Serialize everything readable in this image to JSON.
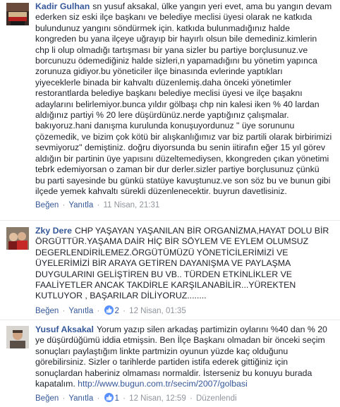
{
  "comments": [
    {
      "author": "Kadir Gulhan",
      "lines": [
        "sn yusuf aksakal, ülke yangın yeri evet, ama bu yangın devam",
        "ederken siz eski ilçe başkanı ve belediye meclisi üyesi olarak ne katkıda",
        "bulundunuz yangını söndürmek için. katkıda bulunmadığınız halde",
        "kongreden bu yana ilçeye uğrayıp bir hayırlı olsun bile demediniz.kimlerin",
        "chp li olup olmadığı tartışması bir yana sizler bu partiye borçlusunuz.ve",
        "borcunuzu ödemediğiniz halde sizleri,n yapamadığını bu yönetim yapınca",
        "zorunuza gidiyor.bu yöneticiler ilçe binasında evlerinde yaptıkları",
        "yiyeceklerle binada bir kahvaltı düzenlemiş.daha önceki yönetimler",
        "restorantlarda belediye başkanı belediye meclisi üyesi ve ilçe başaknı",
        "adaylarını belirlemiyor.bunca yıldır gölbaşı chp nin kalesi iken % 40 lardan",
        "aldığınız partiyi % 20 lere düşürdünüz.nerde yaptığınız çalışmalar.",
        "bakıyoruz.hani danışma kurulunda konuşuyordunuz \" üye sorununu",
        "çözemedik, ve bizim çok kötü bir alışkanlığımız var biz partili olarak birbirimizi",
        "sevmiyoruz\" demiştiniz. doğru diyorsunda bu senin iitirafın eğer 15 yıl görev",
        "aldığın bir partinin üye yapısını düzeltemediysen, kkongreden çıkan yönetimi",
        "tebrk edemiyorsan o zaman bir dur derler.sizler partiye borçlusunuz çünkü",
        "bu parti sayesinde bu günkü statüye kavuştunuz.ve son söz bu ve bunun gibi",
        "ilçede yemek kahvaltı sürekli düzenlenecektir. buyrun davetlisiniz."
      ],
      "like": "Beğen",
      "reply": "Yanıtla",
      "date": "11 Nisan, 21:31"
    },
    {
      "author": "Zky Dere",
      "lines": [
        "CHP YAŞAYAN YAŞANILAN BİR ORGANİZMA,HAYAT DOLU BİR",
        "ÖRGÜTTÜR.YAŞAMA DAİR HİÇ BİR SÖYLEM VE EYLEM OLUMSUZ",
        "DEGERLENDİRİLEMEZ.ÖRGÜTÜMÜZÜ YÖNETİCİLERİMİZİ VE",
        "ÜYELERİMİZİ BİR ARAYA GETİREN DAYANIŞMA VE PAYLAŞMA",
        "DUYGULARINI GELİŞTİREN BU VB.. TÜRDEN ETKİNLİKLER VE",
        "FAALİYETLER ANCAK TAKDİRLE KARŞILANABİLİR...YÜREKTEN",
        "KUTLUYOR , BAŞARILAR DİLİYORUZ........"
      ],
      "like": "Beğen",
      "reply": "Yanıtla",
      "likes": "2",
      "date": "12 Nisan, 01:35"
    },
    {
      "author": "Yusuf Aksakal",
      "lines": [
        "Yorum yazıp silen arkadaş partimizin oylarını %40 dan % 20",
        "ye düşürdüğümü iddia etmişsin. Ben İlçe Başkanı olmadan bir önceki seçim",
        "sonuçları paylaştığım linkte partmizin oyunun yüzde kaç olduğunu",
        "görebilirsiniz. Sizler o tarihlerde partiden istifa ederek gittiğiniz için",
        "sonuçlardan haberiniz olmaması normaldir. İsterseniz bu konuyu burada",
        "kapatalım."
      ],
      "link": "http://www.bugun.com.tr/secim/2007/golbasi",
      "like": "Beğen",
      "reply": "Yanıtla",
      "likes": "1",
      "date": "12 Nisan, 12:59",
      "edited": "Düzenlendi"
    }
  ],
  "colors": {
    "name": "#365899",
    "meta": "#90949c",
    "like_badge": "#5890ff",
    "text": "#1d2129"
  }
}
